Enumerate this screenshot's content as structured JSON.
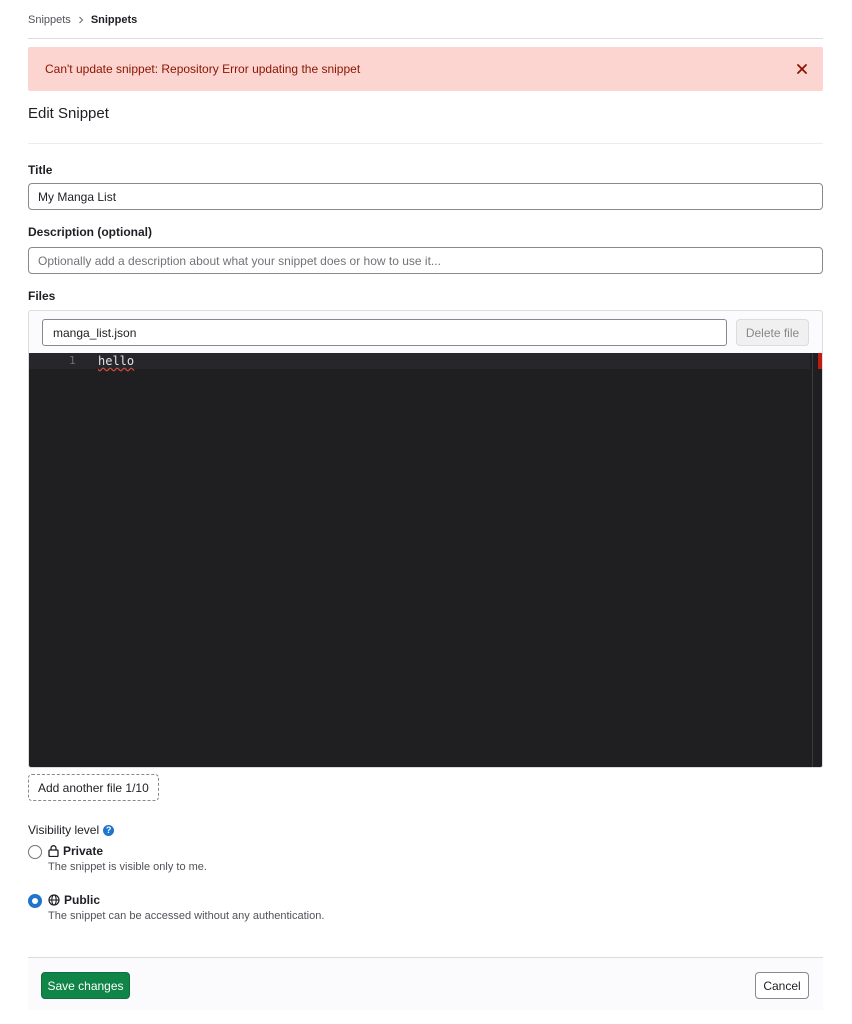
{
  "breadcrumb": {
    "items": [
      "Snippets",
      "Snippets"
    ]
  },
  "alert": {
    "message": "Can't update snippet: Repository Error updating the snippet"
  },
  "page": {
    "title": "Edit Snippet"
  },
  "form": {
    "title_label": "Title",
    "title_value": "My Manga List",
    "description_label": "Description (optional)",
    "description_placeholder": "Optionally add a description about what your snippet does or how to use it...",
    "files_label": "Files",
    "file": {
      "name": "manga_list.json",
      "delete_label": "Delete file",
      "lines": [
        {
          "number": "1",
          "text": "hello"
        }
      ]
    },
    "add_file_label": "Add another file 1/10"
  },
  "visibility": {
    "label": "Visibility level",
    "options": [
      {
        "title": "Private",
        "help": "The snippet is visible only to me.",
        "icon": "lock-icon",
        "checked": false
      },
      {
        "title": "Public",
        "help": "The snippet can be accessed without any authentication.",
        "icon": "globe-icon",
        "checked": true
      }
    ]
  },
  "footer": {
    "save_label": "Save changes",
    "cancel_label": "Cancel"
  },
  "colors": {
    "alert_bg": "#fcd5d1",
    "alert_text": "#8d1300",
    "primary": "#108548",
    "radio_selected": "#1f75cb",
    "editor_bg": "#1f1f22"
  }
}
